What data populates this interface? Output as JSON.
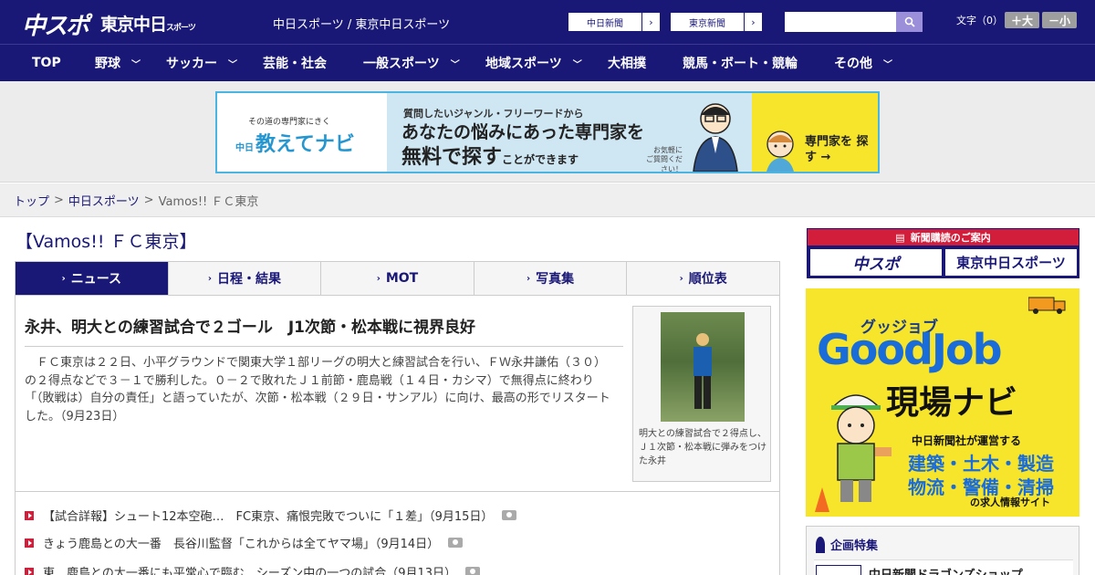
{
  "header": {
    "logo_chunichi": "中スポ",
    "logo_tokyo": "東京中日",
    "logo_tokyo_small": "スポーツ",
    "site_title": "中日スポーツ / 東京中日スポーツ",
    "link1_label": "中日新聞",
    "link2_label": "東京新聞",
    "search_placeholder": "",
    "font_size_label": "文字（0）",
    "font_up_label": "＋大",
    "font_down_label": "－小"
  },
  "nav": {
    "items": [
      {
        "label": "TOP"
      },
      {
        "label": "野球"
      },
      {
        "label": "サッカー"
      },
      {
        "label": "芸能・社会"
      },
      {
        "label": "一般スポーツ"
      },
      {
        "label": "地域スポーツ"
      },
      {
        "label": "大相撲"
      },
      {
        "label": "競馬・ボート・競輪"
      },
      {
        "label": "その他"
      }
    ]
  },
  "banner": {
    "tagline": "その道の専門家にきく",
    "brand_prefix": "中日",
    "brand": "教えてナビ",
    "sub": "質問したいジャンル・フリーワードから",
    "main": "あなたの悩みにあった専門家を",
    "free_big": "無料で探す",
    "free_small": "ことができます",
    "note": "お気軽に ご質問ください！",
    "cta": "専門家を 探す →"
  },
  "breadcrumb": {
    "home": "トップ",
    "section": "中日スポーツ",
    "current": "Vamos!! ＦＣ東京",
    "sep": ">"
  },
  "page": {
    "heading": "【Vamos!! ＦＣ東京】"
  },
  "tabs": [
    {
      "label": "ニュース",
      "active": true
    },
    {
      "label": "日程・結果"
    },
    {
      "label": "MOT"
    },
    {
      "label": "写真集"
    },
    {
      "label": "順位表"
    }
  ],
  "article": {
    "title": "永井、明大との練習試合で２ゴール　J1次節・松本戦に視界良好",
    "body": "ＦＣ東京は２２日、小平グラウンドで関東大学１部リーグの明大と練習試合を行い、ＦＷ永井謙佑（３０）の２得点などで３－１で勝利した。０－２で敗れたＪ１前節・鹿島戦（１４日・カシマ）で無得点に終わり「（敗戦は）自分の責任」と語っていたが、次節・松本戦（２９日・サンアル）に向け、最高の形でリスタートした。（9月23日）",
    "caption": "明大との練習試合で２得点し、Ｊ１次節・松本戦に弾みをつけた永井"
  },
  "news": [
    {
      "title": "【試合詳報】シュート12本空砲…　FC東京、痛恨完敗でついに「１差」（9月15日）"
    },
    {
      "title": "きょう鹿島との大一番　長谷川監督「これからは全てヤマ場」（9月14日）"
    },
    {
      "title": "東　鹿島との大一番にも平常心で臨む　シーズン中の一つの試合（9月13日）"
    }
  ],
  "sidebar": {
    "subscribe_head": "新聞購読のご案内",
    "subscribe_btn1": "中スポ",
    "subscribe_btn2": "東京中日スポーツ",
    "gj_kana": "グッジョブ",
    "gj_title": "GoodJob",
    "gj_navi": "現場ナビ",
    "gj_desc": "中日新聞社が運営する",
    "gj_jobs1": "建築・土木・製造",
    "gj_jobs2": "物流・警備・清掃",
    "gj_foot": "の求人情報サイト",
    "feature_title": "企画特集",
    "feature_item": "中日新聞ドラゴンズショップ"
  },
  "colors": {
    "brand_navy": "#1a1877",
    "accent_red": "#d21e3a",
    "banner_border": "#4cb4e0",
    "goodjob_yellow": "#f6e52b"
  }
}
